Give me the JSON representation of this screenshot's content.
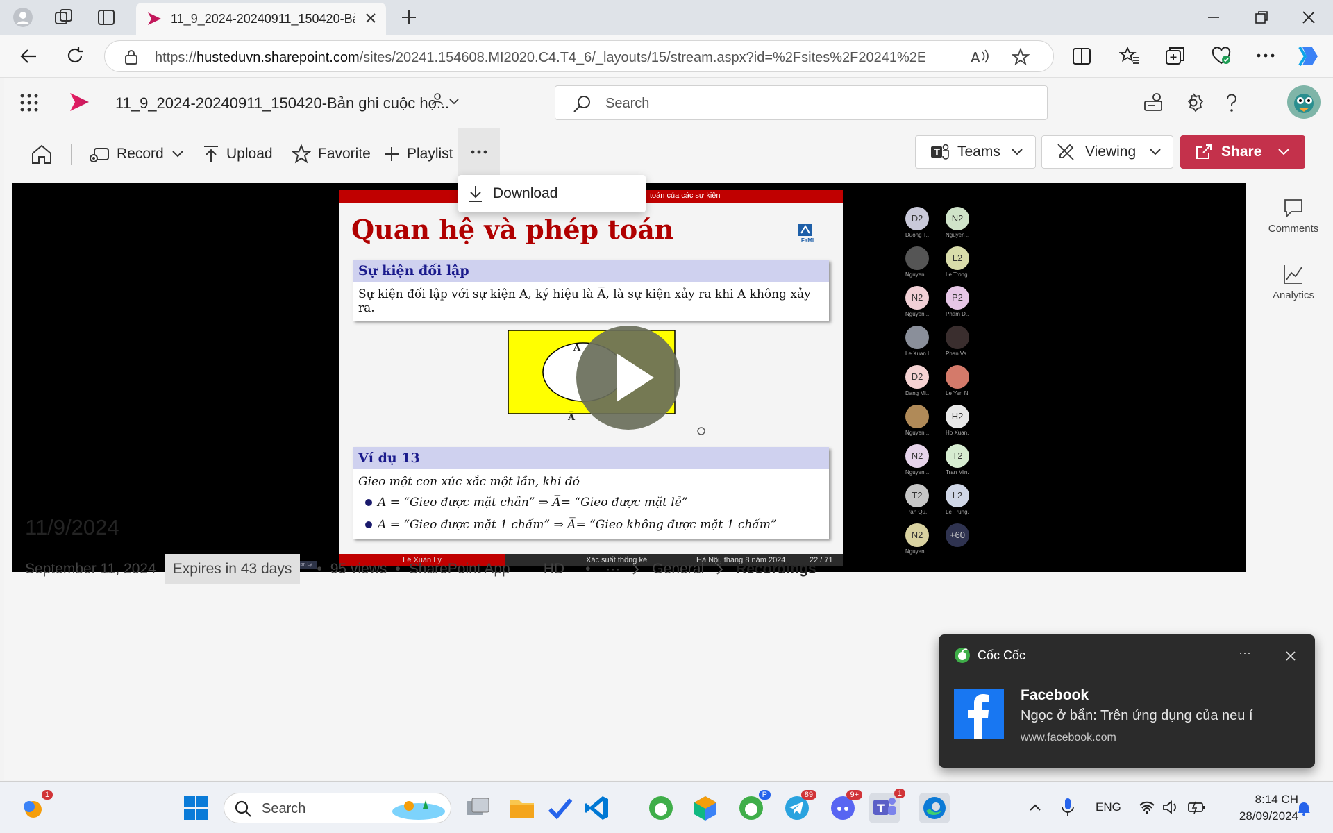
{
  "browser": {
    "tab_title": "11_9_2024-20240911_150420-Bản",
    "url_prefix": "https://",
    "url_host": "husteduvn.sharepoint.com",
    "url_path": "/sites/20241.154608.MI2020.C4.T4_6/_layouts/15/stream.aspx?id=%2Fsites%2F20241%2E..."
  },
  "app": {
    "doc_title": "11_9_2024-20240911_150420-Bản ghi cuộc họ...",
    "search_placeholder": "Search"
  },
  "toolbar": {
    "record": "Record",
    "upload": "Upload",
    "favorite": "Favorite",
    "playlist": "Playlist",
    "more": "···",
    "teams": "Teams",
    "viewing": "Viewing",
    "share": "Share"
  },
  "dropdown": {
    "download": "Download"
  },
  "slide": {
    "crumb": "toán của các sự kiện",
    "heading": "Quan hệ và phép toán",
    "logo": "FaMI",
    "block1_title": "Sự kiện đối lập",
    "block1_body": "Sự kiện đối lập với sự kiện A, ký hiệu là A̅, là sự kiện xảy ra khi A không xảy ra.",
    "venn_a": "A",
    "venn_abar": "A̅",
    "block2_title": "Ví dụ 13",
    "block2_intro": "Gieo một con xúc xắc một lần, khi đó",
    "bullet1": "A = “Gieo được mặt chẵn” ⇒ A̅= “Gieo được mặt lẻ”",
    "bullet2": "A = “Gieo được mặt 1 chấm” ⇒ A̅= “Gieo không được mặt 1 chấm”",
    "footer_author": "Lê Xuân Lý",
    "footer_course": "Xác suất thống kê",
    "footer_place": "Hà Nội, tháng 8 năm 2024",
    "footer_page": "22 / 71",
    "presenter_tag": "Le Xuan Ly"
  },
  "participants": [
    {
      "initials": "D2",
      "name": "Duong T...",
      "color": "#c9c9d9"
    },
    {
      "initials": "N2",
      "name": "Nguyen ...",
      "color": "#cfe3c9"
    },
    {
      "initials": "",
      "name": "Nguyen ...",
      "color": "#555555"
    },
    {
      "initials": "L2",
      "name": "Le Trong...",
      "color": "#d9dcaa"
    },
    {
      "initials": "N2",
      "name": "Nguyen ...",
      "color": "#f1d0d6"
    },
    {
      "initials": "P2",
      "name": "Pham D...",
      "color": "#e6c6e6"
    },
    {
      "initials": "",
      "name": "Le Xuan Ly",
      "color": "#8a8f9a"
    },
    {
      "initials": "",
      "name": "Phan Va...",
      "color": "#3a2e2e"
    },
    {
      "initials": "D2",
      "name": "Dang Mi...",
      "color": "#f5d2d2"
    },
    {
      "initials": "",
      "name": "Le Yen N...",
      "color": "#d47a6a"
    },
    {
      "initials": "",
      "name": "Nguyen ...",
      "color": "#b08a58"
    },
    {
      "initials": "H2",
      "name": "Ho Xuan...",
      "color": "#e8e8e8"
    },
    {
      "initials": "N2",
      "name": "Nguyen ...",
      "color": "#e6d3ea"
    },
    {
      "initials": "T2",
      "name": "Tran Min...",
      "color": "#d6ecd0"
    },
    {
      "initials": "T2",
      "name": "Tran Qu...",
      "color": "#c6c6c6"
    },
    {
      "initials": "L2",
      "name": "Le Trung...",
      "color": "#cfd6e6"
    },
    {
      "initials": "N2",
      "name": "Nguyen ...",
      "color": "#d9d2a0"
    },
    {
      "initials": "+60",
      "name": "",
      "color": "#2f3350"
    }
  ],
  "rail": {
    "comments": "Comments",
    "analytics": "Analytics"
  },
  "video_meta": {
    "title": "11/9/2024",
    "date": "September 11, 2024",
    "expires": "Expires in 43 days",
    "views": "95 views",
    "app": "SharePoint App",
    "quality": "HD",
    "crumb_more": "···",
    "crumb_general": "General",
    "crumb_recordings": "Recordings",
    "sep": "•"
  },
  "toast": {
    "app": "Cốc Cốc",
    "title": "Facebook",
    "body": "Ngọc ở bẩn: Trên ứng dụng của neu í",
    "site": "www.facebook.com",
    "more": "···"
  },
  "taskbar": {
    "search_placeholder": "Search",
    "lang": "ENG",
    "time": "8:14 CH",
    "date": "28/09/2024",
    "badge_weather": "1",
    "badge_telegram": "89",
    "badge_discord": "9+",
    "badge_teams": "1",
    "badge_coccoc": "P"
  },
  "colors": {
    "accent": "#c4314b",
    "stream": "#c2185b"
  }
}
